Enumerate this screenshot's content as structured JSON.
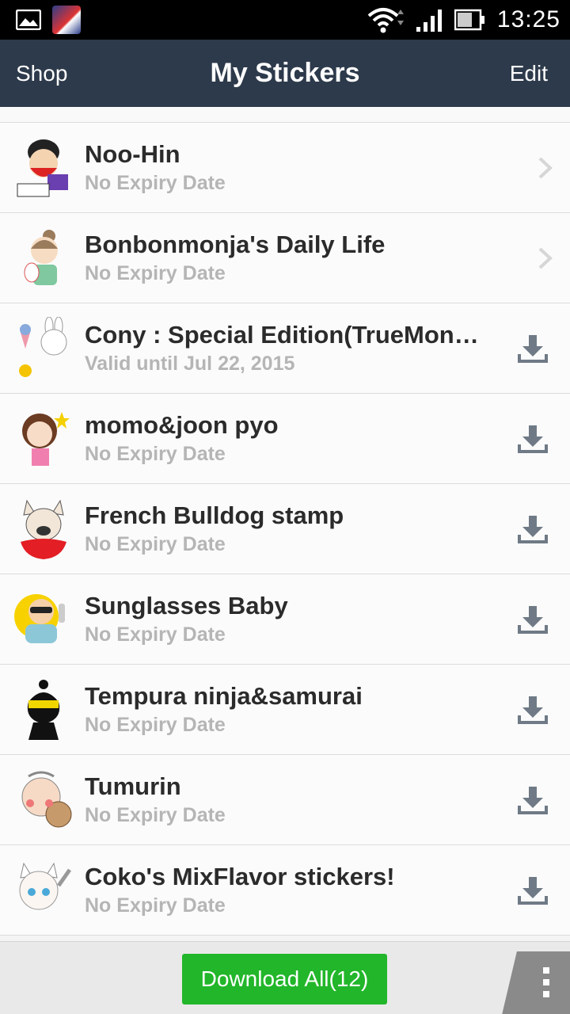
{
  "status_bar": {
    "time": "13:25"
  },
  "header": {
    "left_label": "Shop",
    "title": "My Stickers",
    "right_label": "Edit"
  },
  "stickers": [
    {
      "name": "Noo-Hin",
      "status": "No Expiry Date",
      "action": "chevron"
    },
    {
      "name": "Bonbonmonja's Daily Life",
      "status": "No Expiry Date",
      "action": "chevron"
    },
    {
      "name": "Cony : Special Edition(TrueMone…",
      "status": "Valid until Jul 22, 2015",
      "action": "download"
    },
    {
      "name": "momo&joon pyo",
      "status": "No Expiry Date",
      "action": "download"
    },
    {
      "name": "French Bulldog stamp",
      "status": "No Expiry Date",
      "action": "download"
    },
    {
      "name": "Sunglasses Baby",
      "status": "No Expiry Date",
      "action": "download"
    },
    {
      "name": "Tempura ninja&samurai",
      "status": "No Expiry Date",
      "action": "download"
    },
    {
      "name": "Tumurin",
      "status": "No Expiry Date",
      "action": "download"
    },
    {
      "name": "Coko's MixFlavor stickers!",
      "status": "No Expiry Date",
      "action": "download"
    }
  ],
  "bottom_bar": {
    "download_all_label": "Download All(12)"
  },
  "colors": {
    "header_bg": "#2d3a4b",
    "download_all_bg": "#22b62a",
    "sub_text": "#b5b5b5",
    "icon_gray": "#6f7a86"
  }
}
